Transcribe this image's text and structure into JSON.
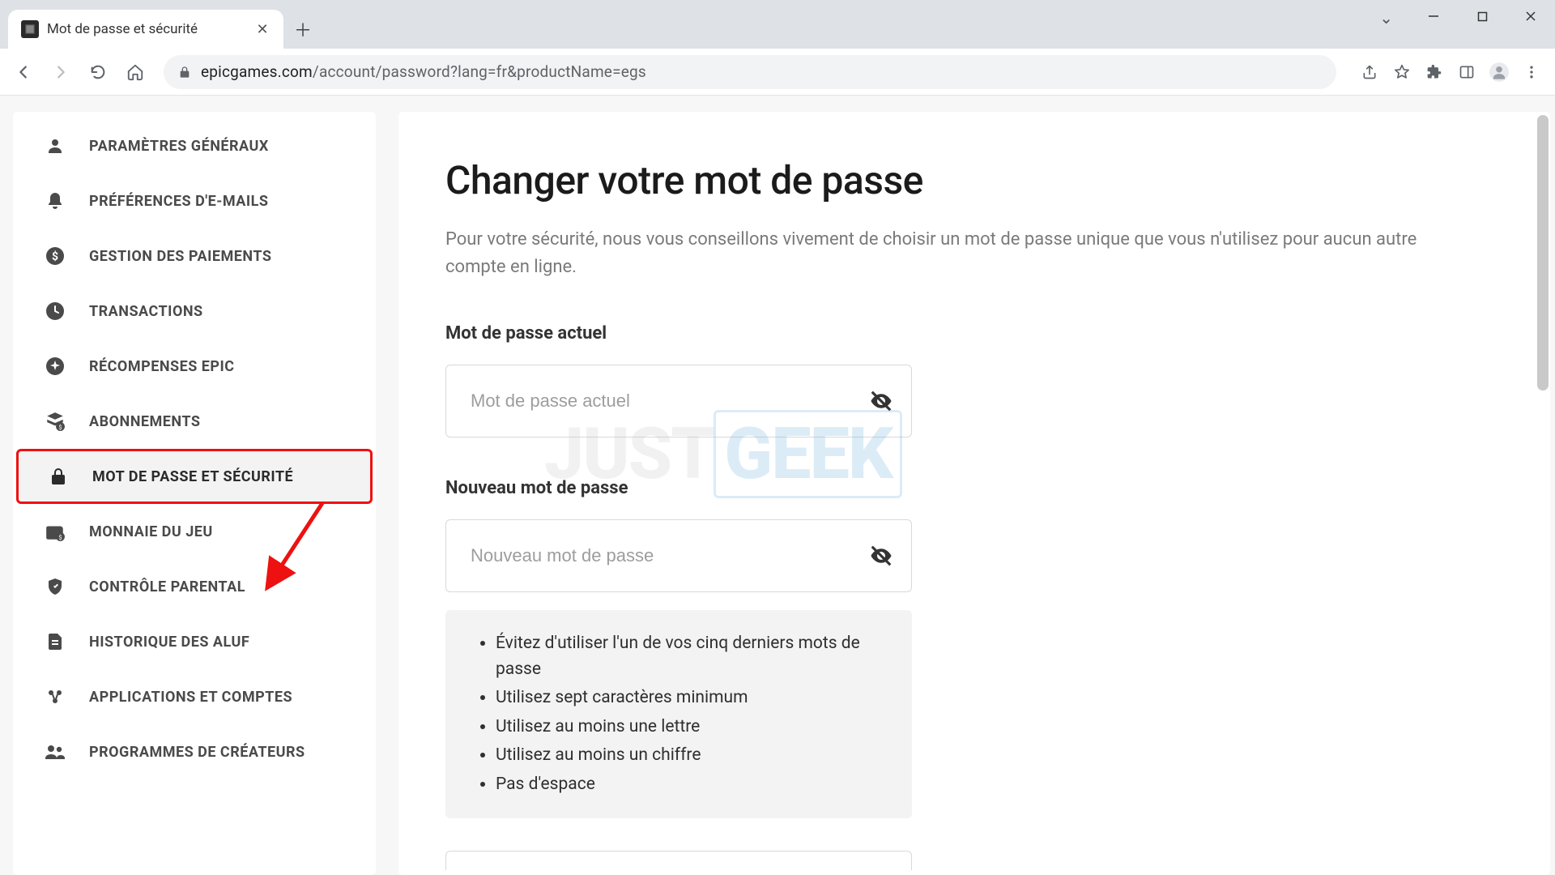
{
  "browser": {
    "tab_title": "Mot de passe et sécurité",
    "url_domain": "epicgames.com",
    "url_path": "/account/password?lang=fr&productName=egs"
  },
  "sidebar": {
    "items": [
      {
        "icon": "person",
        "label": "Paramètres généraux"
      },
      {
        "icon": "bell",
        "label": "Préférences d'e-mails"
      },
      {
        "icon": "dollar",
        "label": "Gestion des paiements"
      },
      {
        "icon": "clock",
        "label": "Transactions"
      },
      {
        "icon": "sparkle",
        "label": "Récompenses Epic"
      },
      {
        "icon": "subscription",
        "label": "Abonnements"
      },
      {
        "icon": "lock",
        "label": "Mot de passe et sécurité",
        "active": true
      },
      {
        "icon": "coin",
        "label": "Monnaie du jeu"
      },
      {
        "icon": "shield",
        "label": "Contrôle parental"
      },
      {
        "icon": "doc",
        "label": "Historique des ALUF"
      },
      {
        "icon": "apps",
        "label": "Applications et comptes"
      },
      {
        "icon": "people",
        "label": "Programmes de créateurs"
      }
    ]
  },
  "main": {
    "heading": "Changer votre mot de passe",
    "subtitle": "Pour votre sécurité, nous vous conseillons vivement de choisir un mot de passe unique que vous n'utilisez pour aucun autre compte en ligne.",
    "current_password": {
      "label": "Mot de passe actuel",
      "placeholder": "Mot de passe actuel"
    },
    "new_password": {
      "label": "Nouveau mot de passe",
      "placeholder": "Nouveau mot de passe"
    },
    "rules": [
      "Évitez d'utiliser l'un de vos cinq derniers mots de passe",
      "Utilisez sept caractères minimum",
      "Utilisez au moins une lettre",
      "Utilisez au moins un chiffre",
      "Pas d'espace"
    ]
  },
  "watermark": {
    "part1": "JUST",
    "part2": "GEEK"
  }
}
